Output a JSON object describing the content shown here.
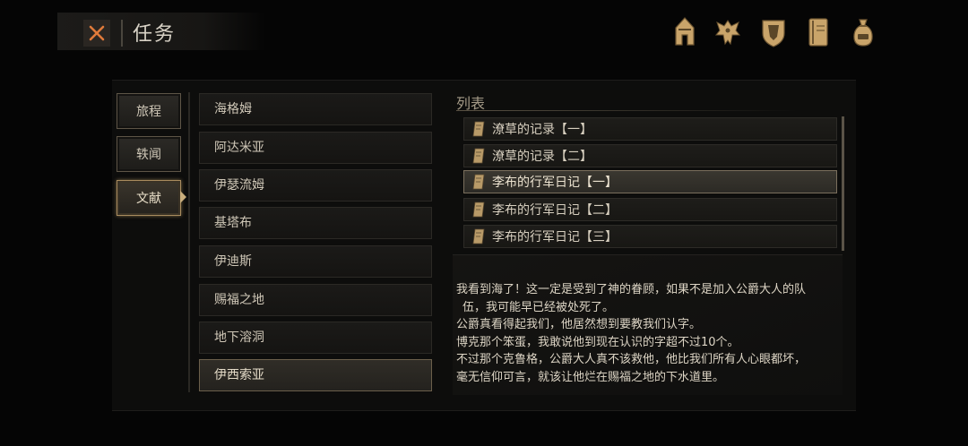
{
  "header": {
    "close_icon": "close-x-icon",
    "title": "任务"
  },
  "top_icons": [
    "helmet-icon",
    "bird-crest-icon",
    "shield-crest-icon",
    "journal-icon",
    "pouch-icon"
  ],
  "colors": {
    "accent_orange": "#e07a3a",
    "gold": "#c9a46a",
    "selected_border": "#a88b5e"
  },
  "categories": [
    {
      "label": "旅程",
      "active": false
    },
    {
      "label": "轶闻",
      "active": false
    },
    {
      "label": "文献",
      "active": true
    }
  ],
  "regions": [
    {
      "label": "海格姆"
    },
    {
      "label": "阿达米亚"
    },
    {
      "label": "伊瑟流姆"
    },
    {
      "label": "基塔布"
    },
    {
      "label": "伊迪斯"
    },
    {
      "label": "赐福之地"
    },
    {
      "label": "地下溶洞"
    },
    {
      "label": "伊西索亚",
      "selected": true
    }
  ],
  "documents": {
    "heading": "列表",
    "items": [
      {
        "label": "潦草的记录【一】"
      },
      {
        "label": "潦草的记录【二】"
      },
      {
        "label": "李布的行军日记【一】",
        "selected": true
      },
      {
        "label": "李布的行军日记【二】"
      },
      {
        "label": "李布的行军日记【三】"
      }
    ]
  },
  "document_text": [
    "我看到海了！这一定是受到了神的眷顾，如果不是加入公爵大人的队",
    "伍，我可能早已经被处死了。",
    "公爵真看得起我们，他居然想到要教我们认字。",
    "博克那个笨蛋，我敢说他到现在认识的字超不过10个。",
    "不过那个克鲁格，公爵大人真不该救他，他比我们所有人心眼都坏，",
    "毫无信仰可言，就该让他烂在赐福之地的下水道里。"
  ]
}
